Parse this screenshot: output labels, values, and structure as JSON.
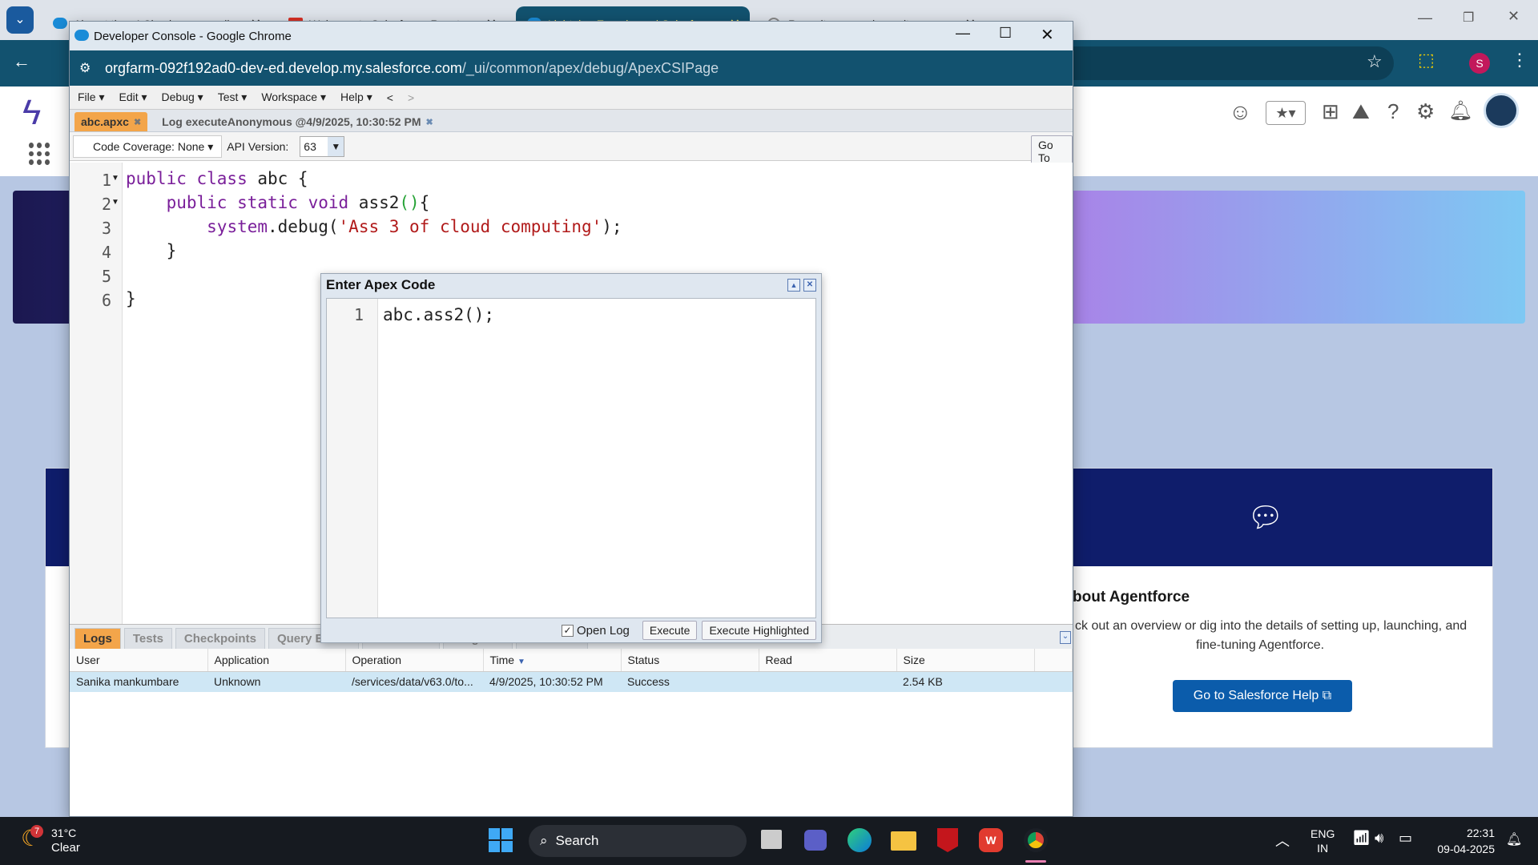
{
  "browser": {
    "tabs": [
      {
        "label": "Almost there! Check your email..."
      },
      {
        "label": "Welcome to Salesforce: Reset y..."
      },
      {
        "label": "Lightning Experience | Salesfor..."
      },
      {
        "label": "Repository search results"
      }
    ]
  },
  "devconsole": {
    "window_title": "Developer Console - Google Chrome",
    "url_host": "orgfarm-092f192ad0-dev-ed.develop.my.salesforce.com",
    "url_path": "/_ui/common/apex/debug/ApexCSIPage",
    "menu": [
      "File",
      "Edit",
      "Debug",
      "Test",
      "Workspace",
      "Help",
      "<",
      ">"
    ],
    "file_tabs": [
      {
        "label": "abc.apxc"
      },
      {
        "label": "Log executeAnonymous @4/9/2025, 10:30:52 PM"
      }
    ],
    "toolbar": {
      "coverage": "Code Coverage: None",
      "api_label": "API Version:",
      "api_value": "63",
      "goto": "Go To"
    },
    "code_lines": [
      "1",
      "2",
      "3",
      "4",
      "5",
      "6"
    ],
    "bottom_tabs": [
      "Logs",
      "Tests",
      "Checkpoints",
      "Query Editor",
      "View State",
      "Progress",
      "Problems"
    ],
    "log_columns": [
      "User",
      "Application",
      "Operation",
      "Time",
      "Status",
      "Read",
      "Size"
    ],
    "log_rows": [
      {
        "user": "Sanika mankumbare",
        "application": "Unknown",
        "operation": "/services/data/v63.0/to...",
        "time": "4/9/2025, 10:30:52 PM",
        "status": "Success",
        "read": "",
        "size": "2.54 KB"
      }
    ]
  },
  "modal": {
    "title": "Enter Apex Code",
    "line_no": "1",
    "code": "abc.ass2();",
    "open_log": "Open Log",
    "execute": "Execute",
    "execute_highlighted": "Execute Highlighted"
  },
  "salesforce": {
    "card_title": "Learn About Agentforce",
    "card_text_1": "ck out an overview or dig into the details of setting up, launching, and",
    "card_text_2": "fine-tuning Agentforce.",
    "help_button": "Go to Salesforce Help"
  },
  "taskbar": {
    "weather_temp": "31°C",
    "weather_desc": "Clear",
    "weather_badge": "7",
    "search": "Search",
    "lang": "ENG",
    "region": "IN",
    "time": "22:31",
    "date": "09-04-2025"
  },
  "colors": {
    "accent_orange": "#f3a54a",
    "sf_blue": "#0b5cab",
    "addr_bg": "#12526f"
  }
}
